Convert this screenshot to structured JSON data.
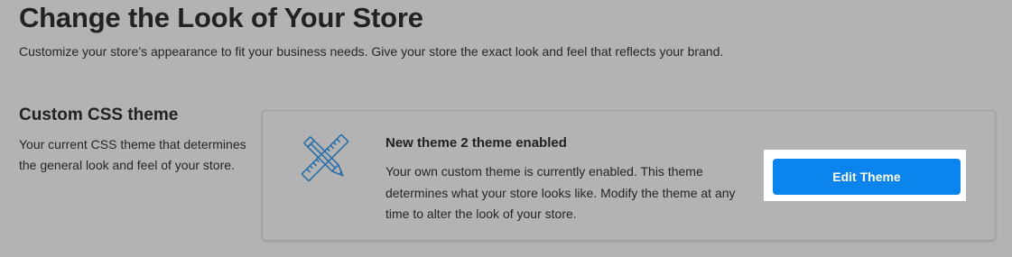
{
  "page": {
    "title": "Change the Look of Your Store",
    "description": "Customize your store’s appearance to fit your business needs. Give your store the exact look and feel that reflects your brand."
  },
  "section": {
    "title": "Custom CSS theme",
    "description": "Your current CSS theme that determines the general look and feel of your store."
  },
  "theme_card": {
    "icon": "ruler-pencil-icon",
    "title": "New theme 2 theme enabled",
    "description": "Your own custom theme is currently enabled. This theme determines what your store looks like. Modify the theme at any time to alter the look of your store.",
    "button_label": "Edit Theme"
  },
  "colors": {
    "background": "#b3b3b3",
    "accent": "#0b84ee",
    "icon_stroke": "#2a6fa8",
    "highlight": "#ffffff"
  }
}
